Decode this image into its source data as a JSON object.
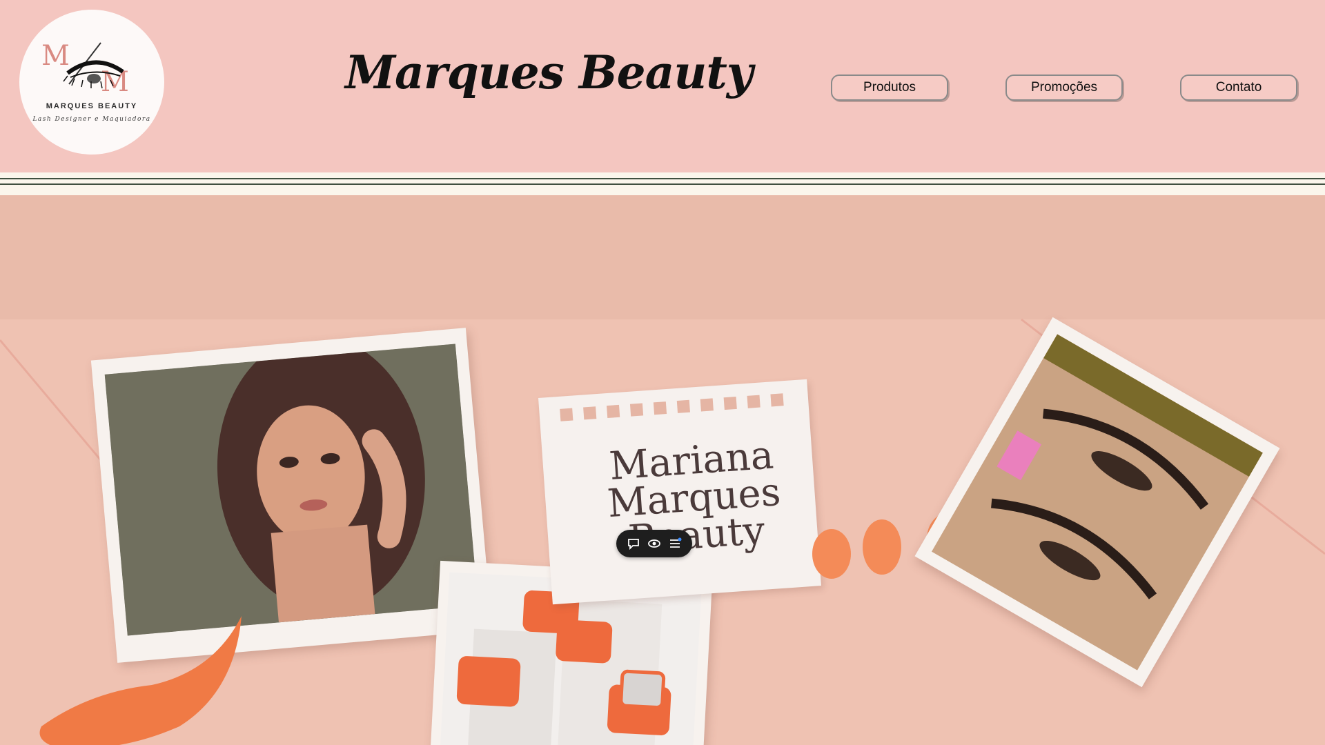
{
  "header": {
    "logo": {
      "monogram": "M/M",
      "name": "MARQUES BEAUTY",
      "subtitle": "Lash Designer e Maquiadora"
    },
    "title": "Marques Beauty",
    "nav": [
      {
        "label": "Produtos"
      },
      {
        "label": "Promoções"
      },
      {
        "label": "Contato"
      }
    ]
  },
  "hero": {
    "note_lines": [
      "Mariana",
      "Marques",
      "Beauty"
    ],
    "toolbar_icons": [
      "comment-icon",
      "eye-icon",
      "menu-icon"
    ]
  },
  "colors": {
    "header_bg": "#f4c6c0",
    "hero_bg": "#e9bbaa",
    "accent_orange": "#f07a45"
  }
}
